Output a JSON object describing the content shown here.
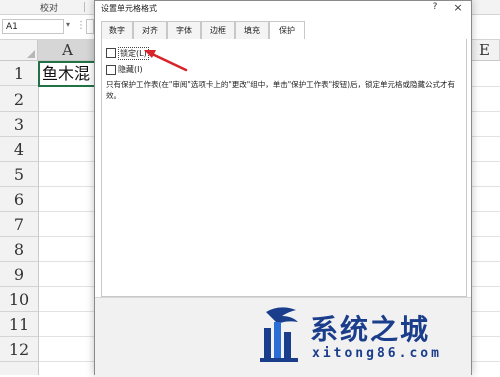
{
  "excel": {
    "ribbon_group_label": "校对",
    "name_box": "A1",
    "columns": [
      "A",
      "E"
    ],
    "rows": [
      "1",
      "2",
      "3",
      "4",
      "5",
      "6",
      "7",
      "8",
      "9",
      "10",
      "11",
      "12"
    ],
    "cell_a1_value": "鱼木混"
  },
  "dialog": {
    "title": "设置单元格格式",
    "help": "?",
    "close": "×",
    "tabs": [
      "数字",
      "对齐",
      "字体",
      "边框",
      "填充",
      "保护"
    ],
    "active_tab": "保护",
    "locked_label": "锁定(L)",
    "locked_checked": false,
    "hidden_label": "隐藏(I)",
    "hidden_checked": false,
    "note": "只有保护工作表(在\"审阅\"选项卡上的\"更改\"组中，单击\"保护工作表\"按钮)后，锁定单元格或隐藏公式才有效。"
  },
  "annotation": {
    "arrow_color": "#d9232a"
  },
  "watermark": {
    "title": "系统之城",
    "url": "xitong86.com",
    "color": "#1a3d8c"
  }
}
